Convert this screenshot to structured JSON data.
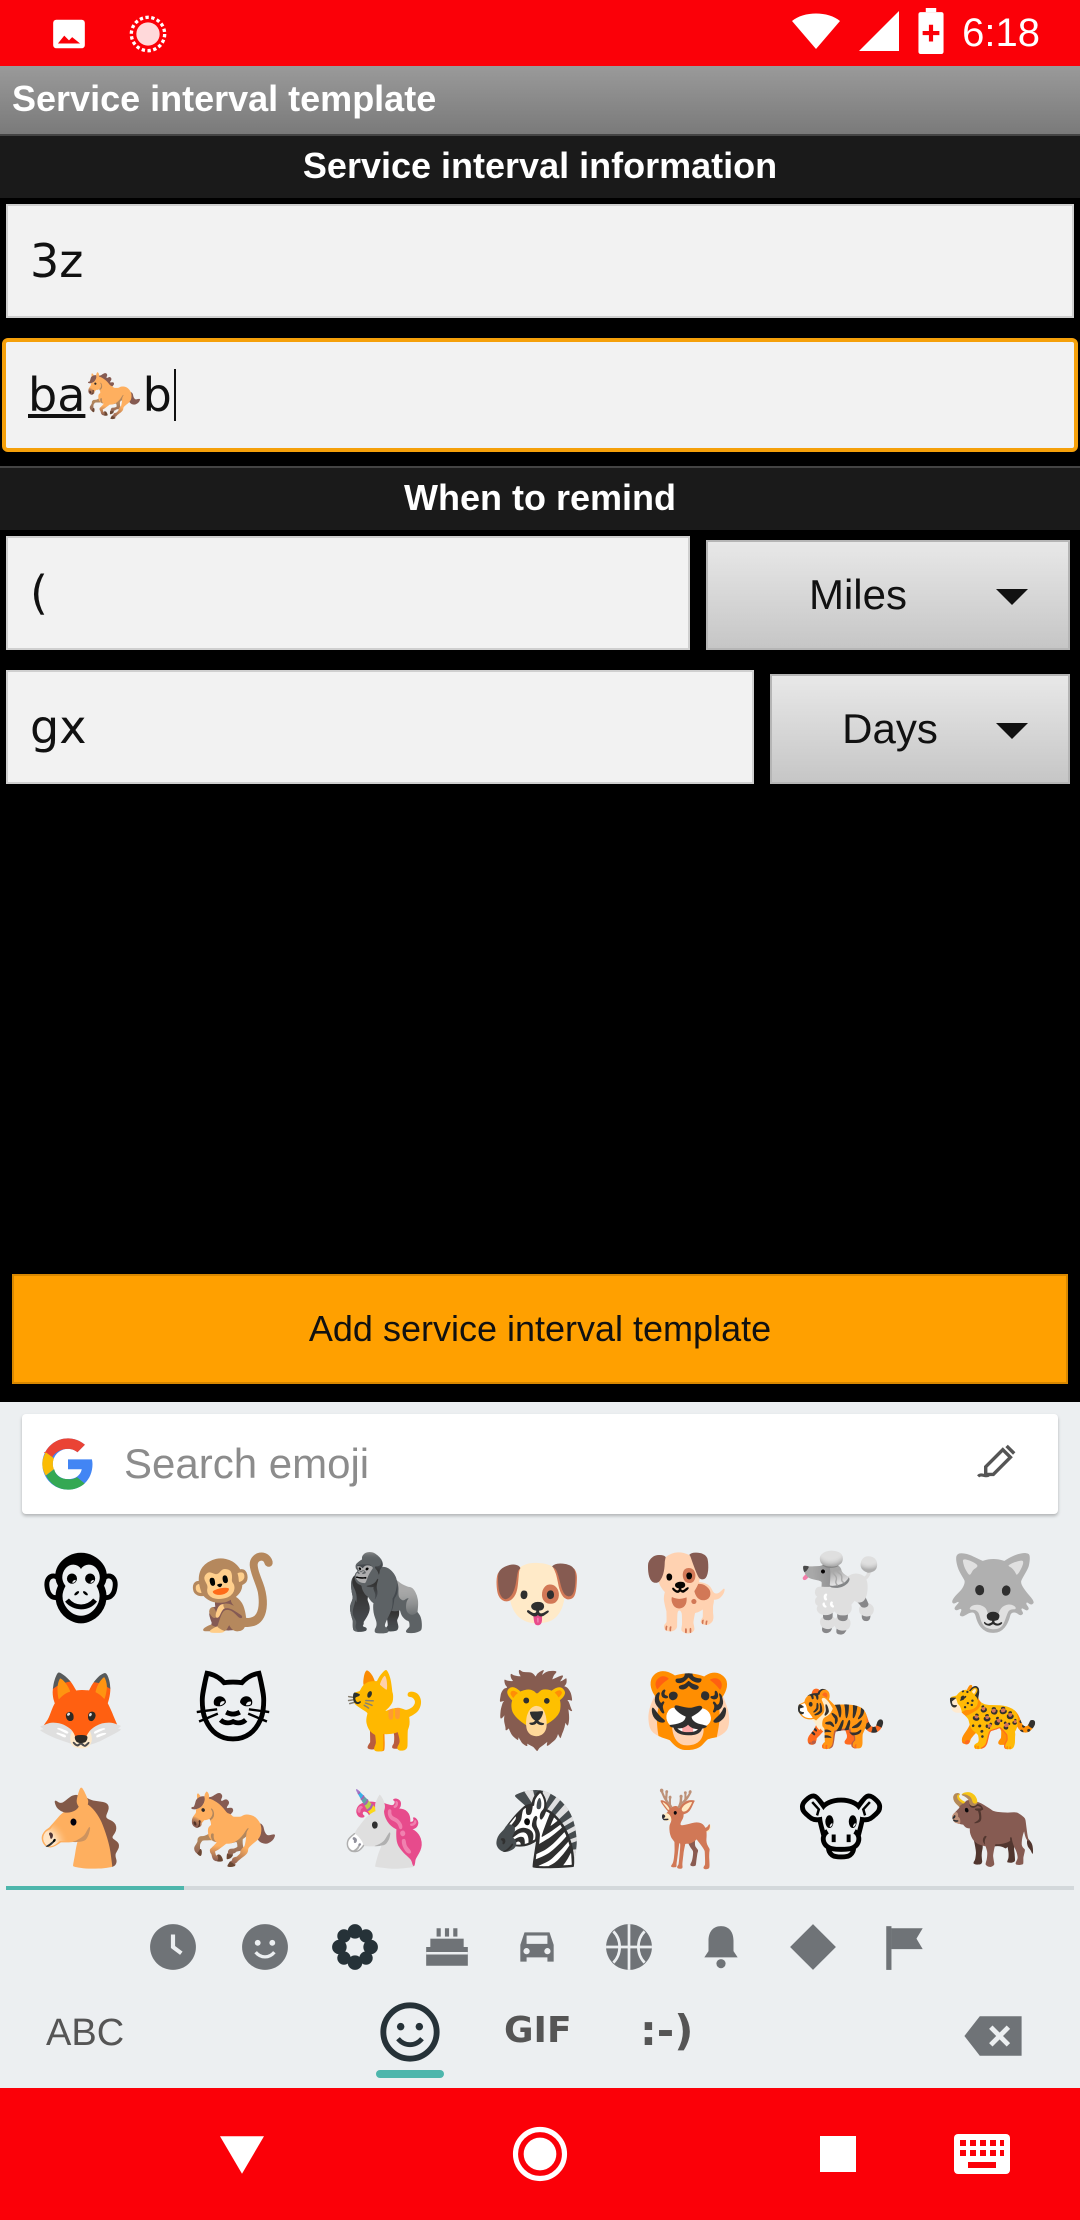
{
  "status_bar": {
    "time": "6:18",
    "icons": [
      "image-icon",
      "record-icon",
      "wifi-icon",
      "signal-icon",
      "battery-icon"
    ]
  },
  "app_bar": {
    "title": "Service interval template"
  },
  "info_section": {
    "header": "Service interval information",
    "field1_value": "3z",
    "field2_value_underlined": "ba",
    "field2_emoji": "🐎",
    "field2_value_rest": "b"
  },
  "remind_section": {
    "header": "When to remind",
    "distance_value": "(",
    "distance_unit": "Miles",
    "time_value": "gx",
    "time_unit": "Days"
  },
  "add_button": {
    "label": "Add service interval template"
  },
  "keyboard": {
    "search_placeholder": "Search emoji",
    "emoji_rows": [
      [
        "🐵",
        "🐒",
        "🦍",
        "🐶",
        "🐕",
        "🐩",
        "🐺"
      ],
      [
        "🦊",
        "🐱",
        "🐈",
        "🦁",
        "🐯",
        "🐅",
        "🐆"
      ],
      [
        "🐴",
        "🐎",
        "🦄",
        "🦓",
        "🦌",
        "🐮",
        "🐂"
      ]
    ],
    "categories": [
      "recent-icon",
      "smileys-icon",
      "nature-icon",
      "food-icon",
      "travel-icon",
      "activity-icon",
      "objects-icon",
      "symbols-icon",
      "flags-icon"
    ],
    "selected_category": "nature-icon",
    "abc_label": "ABC",
    "gif_label": "GIF",
    "emoticon_label": ":-)"
  },
  "colors": {
    "status_bar": "#fb0008",
    "accent": "#ffa000",
    "focus_border": "#f5a00a",
    "keyboard_accent": "#4db6ac"
  }
}
